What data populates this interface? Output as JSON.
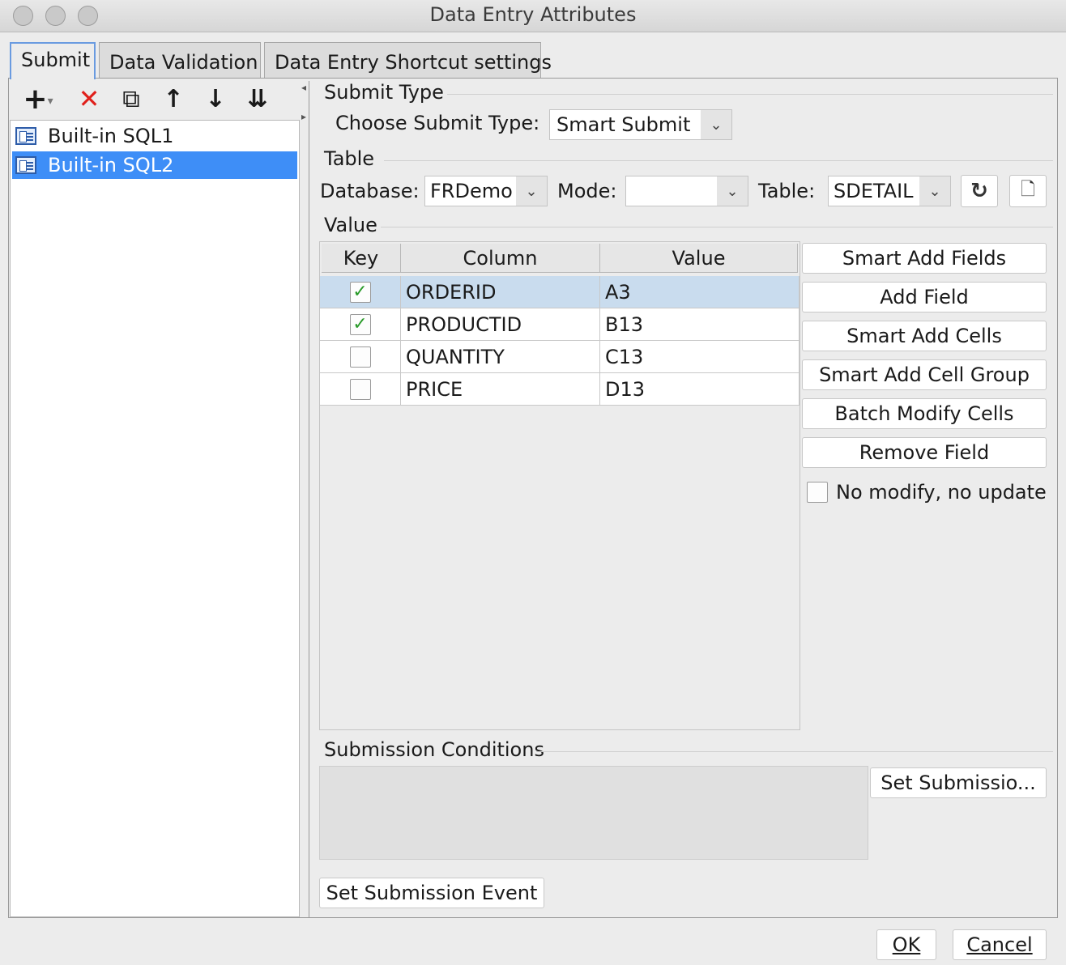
{
  "window": {
    "title": "Data Entry Attributes"
  },
  "tabs": [
    "Submit",
    "Data Validation",
    "Data Entry Shortcut settings"
  ],
  "toolbar": {
    "add": "+",
    "add_menu": "▾",
    "delete": "✕",
    "copy": "⧉",
    "up": "↑",
    "down": "↓",
    "move_bottom": "⇊"
  },
  "sources": [
    {
      "label": "Built-in SQL1",
      "selected": false
    },
    {
      "label": "Built-in SQL2",
      "selected": true
    }
  ],
  "submit_type": {
    "section": "Submit Type",
    "label": "Choose Submit Type:",
    "value": "Smart Submit"
  },
  "table_section": {
    "section": "Table",
    "database_label": "Database:",
    "database_value": "FRDemo",
    "mode_label": "Mode:",
    "mode_value": "",
    "table_label": "Table:",
    "table_value": "SDETAIL"
  },
  "value_section": {
    "section": "Value",
    "headers": [
      "Key",
      "Column",
      "Value"
    ],
    "rows": [
      {
        "key": true,
        "key_mark": "✓",
        "column": "ORDERID",
        "value": "A3"
      },
      {
        "key": true,
        "key_mark": "✓",
        "column": "PRODUCTID",
        "value": "B13"
      },
      {
        "key": false,
        "key_mark": "",
        "column": "QUANTITY",
        "value": "C13"
      },
      {
        "key": false,
        "key_mark": "",
        "column": "PRICE",
        "value": "D13"
      }
    ]
  },
  "side_buttons": [
    "Smart Add Fields",
    "Add Field",
    "Smart Add Cells",
    "Smart Add Cell Group",
    "Batch Modify Cells",
    "Remove Field"
  ],
  "no_modify_label": "No modify, no update",
  "conditions": {
    "section": "Submission Conditions",
    "button": "Set Submissio..."
  },
  "event_button": "Set Submission Event",
  "footer": {
    "ok": "OK",
    "cancel": "Cancel"
  },
  "colors": {
    "selection": "#3e8ef7",
    "row_highlight": "#c9dcee",
    "check": "#2a9b2a",
    "delete": "#e0201b"
  }
}
